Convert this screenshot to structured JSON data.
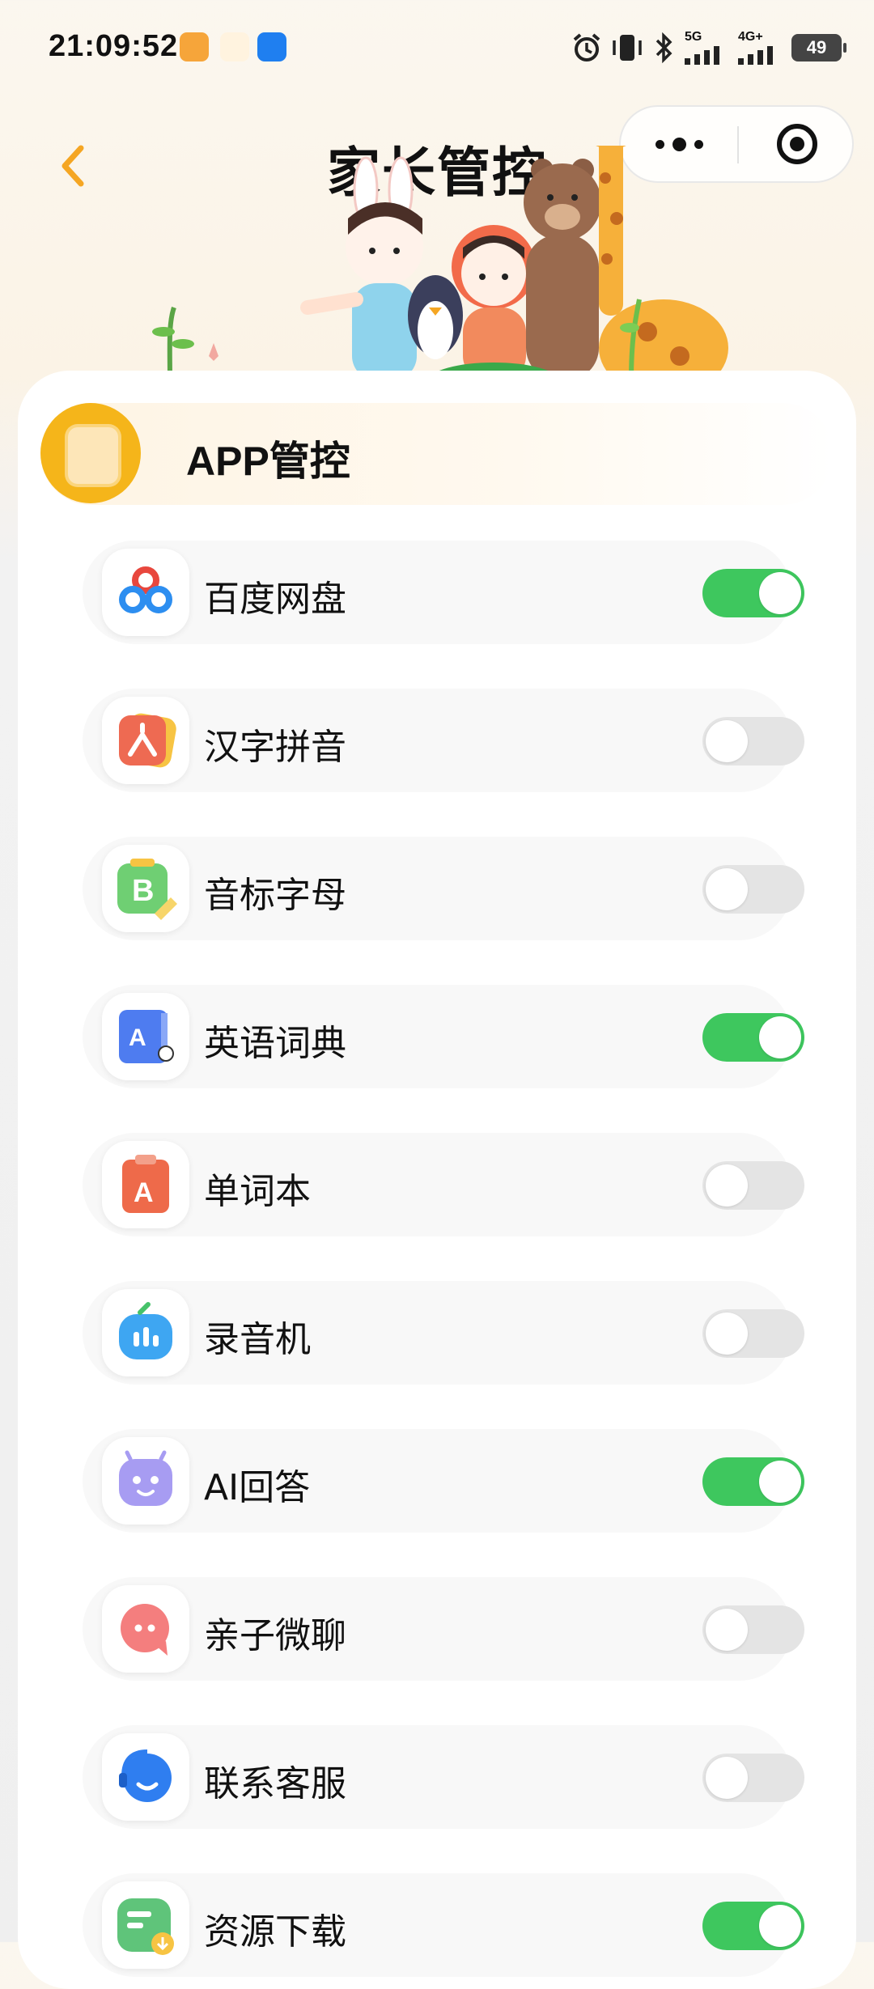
{
  "status_bar": {
    "time": "21:09:52",
    "network_5g": "5G",
    "network_4g": "4G+",
    "battery": "49"
  },
  "header": {
    "title": "家长管控"
  },
  "section": {
    "title": "APP管控"
  },
  "apps": [
    {
      "name": "百度网盘",
      "icon": "baidu-netdisk-icon",
      "enabled": true
    },
    {
      "name": "汉字拼音",
      "icon": "hanzi-pinyin-icon",
      "enabled": false
    },
    {
      "name": "音标字母",
      "icon": "phonetic-letters-icon",
      "enabled": false
    },
    {
      "name": "英语词典",
      "icon": "english-dictionary-icon",
      "enabled": true
    },
    {
      "name": "单词本",
      "icon": "wordbook-icon",
      "enabled": false
    },
    {
      "name": "录音机",
      "icon": "recorder-icon",
      "enabled": false
    },
    {
      "name": "AI回答",
      "icon": "ai-answer-icon",
      "enabled": true
    },
    {
      "name": "亲子微聊",
      "icon": "family-chat-icon",
      "enabled": false
    },
    {
      "name": "联系客服",
      "icon": "customer-service-icon",
      "enabled": false
    },
    {
      "name": "资源下载",
      "icon": "resource-download-icon",
      "enabled": true
    }
  ],
  "colors": {
    "accent": "#f5a623",
    "toggle_on": "#3ec75e",
    "toggle_off": "#e4e4e4"
  }
}
